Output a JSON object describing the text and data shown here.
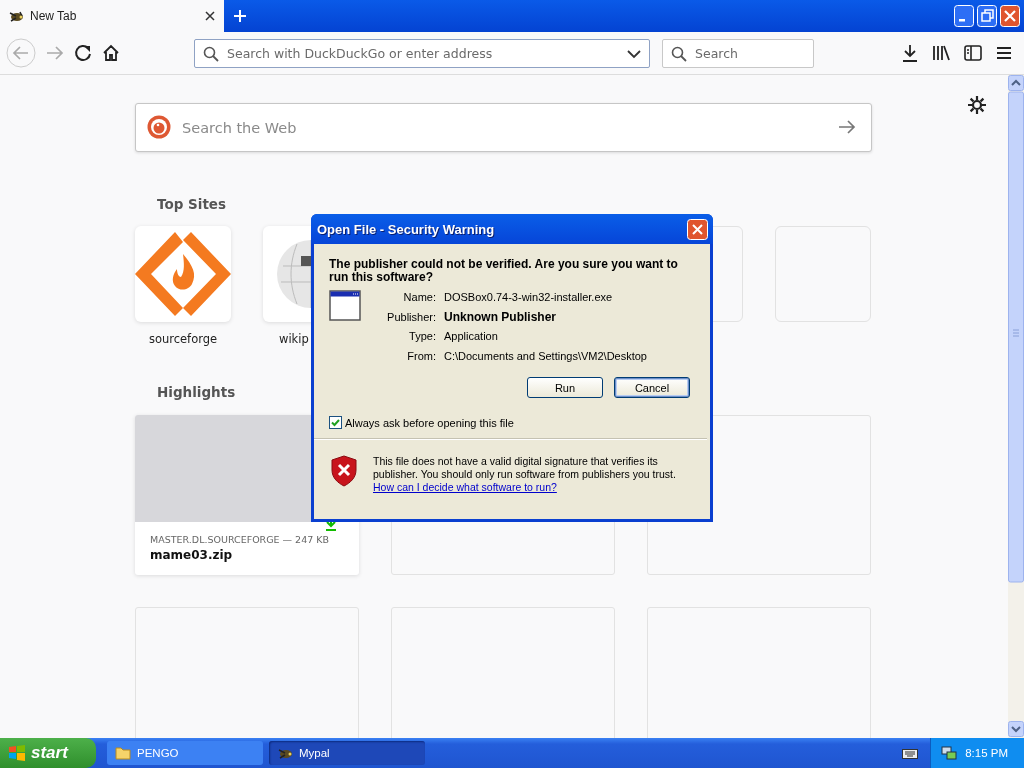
{
  "browser": {
    "tab": {
      "title": "New Tab",
      "selected": true
    },
    "toolbar": {
      "address_placeholder": "Search with DuckDuckGo or enter address",
      "search_placeholder": "Search"
    }
  },
  "newtab": {
    "search_placeholder": "Search the Web",
    "top_sites_heading": "Top Sites",
    "top_sites": [
      {
        "kind": "sourceforge",
        "label": "sourceforge"
      },
      {
        "kind": "wikipedia",
        "label": "wikip",
        "clipped": true
      },
      {
        "kind": "empty"
      },
      {
        "kind": "empty"
      }
    ],
    "highlights_heading": "Highlights",
    "highlights": [
      {
        "kind": "download",
        "source": "MASTER.DL.SOURCEFORGE — 247 KB",
        "title": "mame03.zip"
      },
      {
        "kind": "empty"
      },
      {
        "kind": "empty"
      },
      {
        "kind": "empty"
      },
      {
        "kind": "empty"
      },
      {
        "kind": "empty"
      }
    ]
  },
  "dialog": {
    "title": "Open File - Security Warning",
    "question": "The publisher could not be verified.  Are you sure you want to run this software?",
    "fields": [
      {
        "label": "Name:",
        "value": "DOSBox0.74-3-win32-installer.exe",
        "bold": false
      },
      {
        "label": "Publisher:",
        "value": "Unknown Publisher",
        "bold": true
      },
      {
        "label": "Type:",
        "value": "Application",
        "bold": false
      },
      {
        "label": "From:",
        "value": "C:\\Documents and Settings\\VM2\\Desktop",
        "bold": false
      }
    ],
    "buttons": [
      {
        "label": "Run",
        "focused": false
      },
      {
        "label": "Cancel",
        "focused": true
      }
    ],
    "always_ask": {
      "label": "Always ask before opening this file",
      "checked": true
    },
    "warning": "This file does not have a valid digital signature that verifies its publisher.  You should only run software from publishers you trust.",
    "link": "How can I decide what software to run?"
  },
  "taskbar": {
    "start": "start",
    "tasks": [
      {
        "label": "PENGO",
        "kind": "folder",
        "selected": false
      },
      {
        "label": "Mypal",
        "kind": "app",
        "selected": true
      }
    ],
    "clock": "8:15 PM"
  }
}
